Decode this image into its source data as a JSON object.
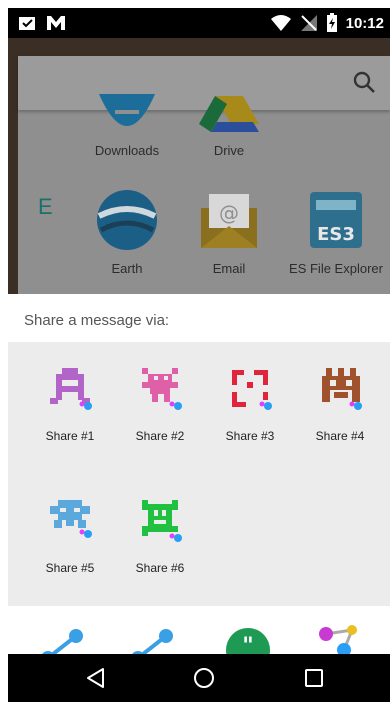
{
  "status_bar": {
    "time": "10:12"
  },
  "launcher": {
    "index_letter": "E",
    "apps": [
      {
        "label": "Downloads",
        "icon": "downloads-icon"
      },
      {
        "label": "Drive",
        "icon": "drive-icon"
      },
      {
        "label": "Earth",
        "icon": "earth-icon"
      },
      {
        "label": "Email",
        "icon": "email-icon"
      },
      {
        "label": "ES File Explorer",
        "icon": "es-file-explorer-icon"
      }
    ]
  },
  "share_sheet": {
    "title": "Share a message via:",
    "targets": [
      {
        "label": "Share #1",
        "color": "#b264c8"
      },
      {
        "label": "Share #2",
        "color": "#e060a8"
      },
      {
        "label": "Share #3",
        "color": "#e0243c"
      },
      {
        "label": "Share #4",
        "color": "#a0522d"
      },
      {
        "label": "Share #5",
        "color": "#5aa8dc"
      },
      {
        "label": "Share #6",
        "color": "#20c040"
      }
    ],
    "more_icons": [
      "share-icon",
      "share-icon",
      "hangouts-icon",
      "molecule-icon"
    ]
  },
  "colors": {
    "sheet_background": "#ececec",
    "header_background": "#ffffff"
  }
}
